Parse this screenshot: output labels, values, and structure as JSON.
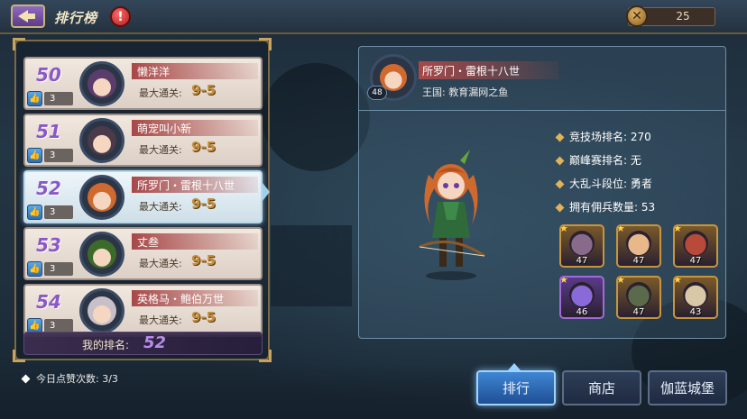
{
  "topbar": {
    "title": "排行榜",
    "info_icon": "exclamation-icon",
    "currency": {
      "icon": "coin-icon",
      "value": "25"
    }
  },
  "ranking": {
    "rows": [
      {
        "rank": "50",
        "name": "懒洋洋",
        "stage_label": "最大通关:",
        "stage": "9-5",
        "likes": "3",
        "avatar_color": "#5b3d6b"
      },
      {
        "rank": "51",
        "name": "萌宠叫小新",
        "stage_label": "最大通关:",
        "stage": "9-5",
        "likes": "3",
        "avatar_color": "#4a3a4a"
      },
      {
        "rank": "52",
        "name": "所罗门・雷根十八世",
        "stage_label": "最大通关:",
        "stage": "9-5",
        "likes": "3",
        "avatar_color": "#d0692e",
        "selected": true
      },
      {
        "rank": "53",
        "name": "丈叁",
        "stage_label": "最大通关:",
        "stage": "9-5",
        "likes": "3",
        "avatar_color": "#3c6a28"
      },
      {
        "rank": "54",
        "name": "英格马・鲍伯万世",
        "stage_label": "最大通关:",
        "stage": "9-5",
        "likes": "3",
        "avatar_color": "#c7c0c8"
      }
    ],
    "my_rank": {
      "label": "我的排名:",
      "value": "52"
    }
  },
  "detail": {
    "level": "48",
    "name": "所罗门・雷根十八世",
    "kingdom": "王国: 教育漏网之鱼",
    "stats": [
      {
        "label": "竞技场排名: 270"
      },
      {
        "label": "巅峰赛排名: 无"
      },
      {
        "label": "大乱斗段位: 勇者"
      },
      {
        "label": "拥有佣兵数量: 53"
      }
    ],
    "mercenaries": [
      {
        "level": "47",
        "frame": "gold",
        "face": "#8a6a8a"
      },
      {
        "level": "47",
        "frame": "gold",
        "face": "#e8b88a"
      },
      {
        "level": "47",
        "frame": "gold",
        "face": "#b84a3a"
      },
      {
        "level": "46",
        "frame": "purple",
        "face": "#8a6ad8"
      },
      {
        "level": "47",
        "frame": "gold",
        "face": "#5a6a4a"
      },
      {
        "level": "43",
        "frame": "gold",
        "face": "#d8c8a8"
      }
    ]
  },
  "footer": {
    "likes_today": "今日点赞次数: 3/3",
    "tabs": [
      {
        "label": "排行",
        "active": true
      },
      {
        "label": "商店",
        "active": false
      },
      {
        "label": "伽蓝城堡",
        "active": false
      }
    ]
  },
  "colors": {
    "accent_purple": "#8a58c8",
    "stage_gold": "#c58d3a",
    "active_tab": "#3f86d4"
  }
}
